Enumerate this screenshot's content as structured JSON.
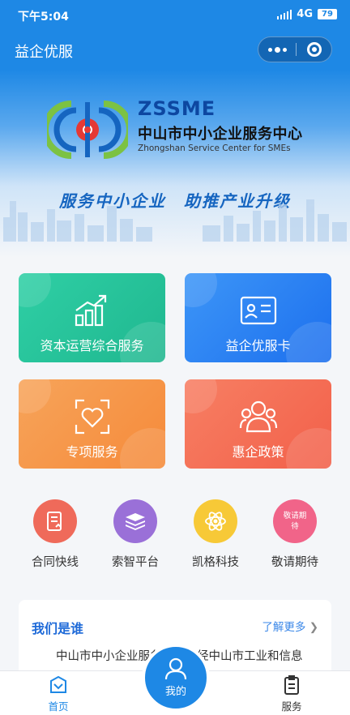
{
  "status": {
    "time": "下午5:04",
    "network": "4G",
    "battery": "79"
  },
  "nav": {
    "title": "益企优服"
  },
  "banner": {
    "logo_en": "ZSSME",
    "logo_cn": "中山市中小企业服务中心",
    "logo_sub": "Zhongshan Service Center for SMEs",
    "slogan": "服务中小企业　助推产业升级"
  },
  "cards": [
    {
      "label": "资本运营综合服务",
      "icon": "growth-chart-icon",
      "color": "#2fcfa5"
    },
    {
      "label": "益企优服卡",
      "icon": "id-card-icon",
      "color": "#3d96f7"
    },
    {
      "label": "专项服务",
      "icon": "heart-scan-icon",
      "color": "#f7a45a"
    },
    {
      "label": "惠企政策",
      "icon": "people-icon",
      "color": "#f77f63"
    }
  ],
  "quick": [
    {
      "label": "合同快线",
      "icon": "contract-icon",
      "color": "#ef6a5a"
    },
    {
      "label": "索智平台",
      "icon": "stack-icon",
      "color": "#9a70d8"
    },
    {
      "label": "凯格科技",
      "icon": "atom-icon",
      "color": "#f7c937"
    },
    {
      "label": "敬请期待",
      "icon_text": "敬请期待",
      "color": "#f16489"
    }
  ],
  "about": {
    "title": "我们是谁",
    "more": "了解更多",
    "text": "中山市中小企业服务中心是经中山市工业和信息"
  },
  "tabs": {
    "home": "首页",
    "mine": "我的",
    "service": "服务"
  }
}
